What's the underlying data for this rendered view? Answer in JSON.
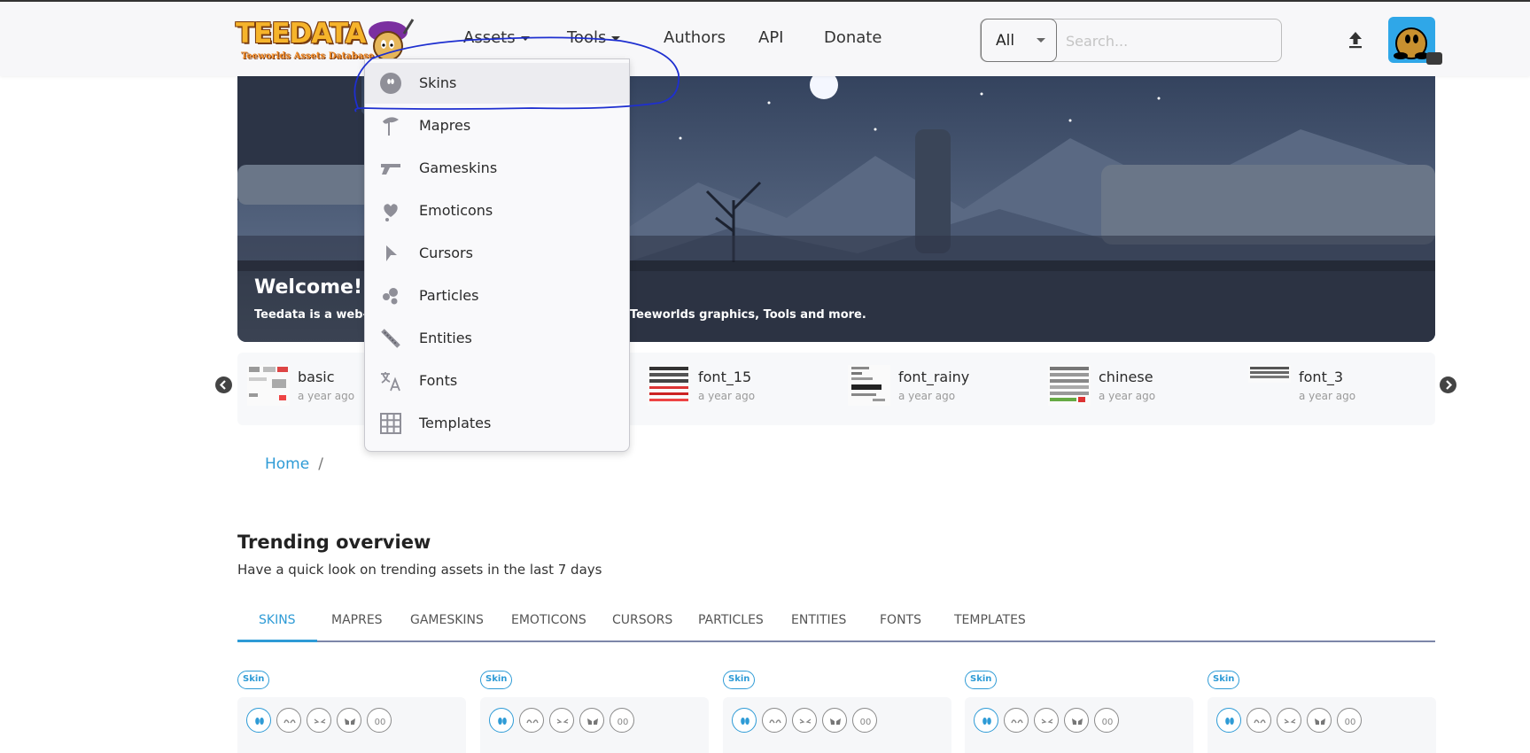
{
  "header": {
    "logo_text": "TEEDATA",
    "logo_subtitle": "Teeworlds Assets Database",
    "nav": {
      "assets": "Assets",
      "tools": "Tools",
      "authors": "Authors",
      "api": "API",
      "donate": "Donate"
    },
    "search": {
      "category": "All",
      "placeholder": "Search..."
    },
    "upload_icon": "upload-icon",
    "avatar_icon": "tee-avatar"
  },
  "assets_menu": {
    "items": [
      {
        "label": "Skins",
        "icon": "skin-icon"
      },
      {
        "label": "Mapres",
        "icon": "tree-icon"
      },
      {
        "label": "Gameskins",
        "icon": "gun-icon"
      },
      {
        "label": "Emoticons",
        "icon": "heart-icon"
      },
      {
        "label": "Cursors",
        "icon": "cursor-icon"
      },
      {
        "label": "Particles",
        "icon": "particles-icon"
      },
      {
        "label": "Entities",
        "icon": "entities-icon"
      },
      {
        "label": "Fonts",
        "icon": "translate-icon"
      },
      {
        "label": "Templates",
        "icon": "grid-icon"
      }
    ],
    "highlighted": "Skins"
  },
  "hero": {
    "title": "Welcome!",
    "text_left": "Teedata is a web-b",
    "text_right": "Teeworlds graphics, Tools and more."
  },
  "carousel": {
    "items": [
      {
        "name": "basic",
        "time": "a year ago"
      },
      {
        "name": "font_15",
        "time": "a year ago"
      },
      {
        "name": "font_rainy",
        "time": "a year ago"
      },
      {
        "name": "chinese",
        "time": "a year ago"
      },
      {
        "name": "font_3",
        "time": "a year ago"
      }
    ]
  },
  "breadcrumb": {
    "home": "Home",
    "separator": "/"
  },
  "trending": {
    "title": "Trending overview",
    "subtitle": "Have a quick look on trending assets in the last 7 days",
    "tabs": [
      "SKINS",
      "MAPRES",
      "GAMESKINS",
      "EMOTICONS",
      "CURSORS",
      "PARTICLES",
      "ENTITIES",
      "FONTS",
      "TEMPLATES"
    ],
    "active_tab": "SKINS",
    "card_badge": "Skin"
  },
  "colors": {
    "accent": "#2e9bd6",
    "annotation": "#1e2fd0"
  }
}
